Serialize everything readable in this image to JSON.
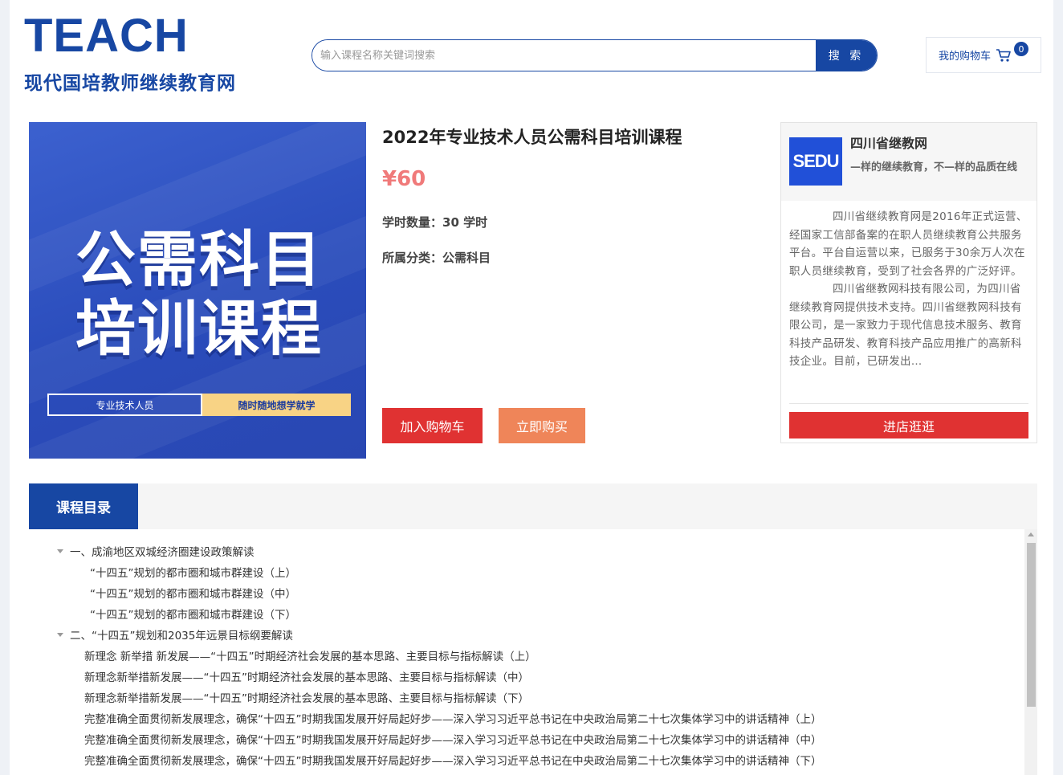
{
  "header": {
    "logo_word": "TEACH",
    "logo_subtitle": "现代国培教师继续教育网",
    "search_placeholder": "输入课程名称关键词搜索",
    "search_button": "搜 索",
    "cart_label": "我的购物车",
    "cart_count": "0"
  },
  "cover": {
    "line1": "公需科目",
    "line2": "培训课程",
    "tag_left": "专业技术人员",
    "tag_right": "随时随地想学就学"
  },
  "product": {
    "title": "2022年专业技术人员公需科目培训课程",
    "price": "¥60",
    "hours_label": "学时数量：",
    "hours_value": "30 学时",
    "category_label": "所属分类：",
    "category_value": "公需科目",
    "add_cart_button": "加入购物车",
    "buy_now_button": "立即购买"
  },
  "store": {
    "logo_text": "SEDU",
    "name": "四川省继教网",
    "slogan": "—样的继续教育，不—样的品质在线",
    "desc_p1": "四川省继续教育网是2016年正式运营、经国家工信部备案的在职人员继续教育公共服务平台。平台自运营以来，已服务于30余万人次在职人员继续教育，受到了社会各界的广泛好评。",
    "desc_p2": "四川省继教网科技有限公司，为四川省继续教育网提供技术支持。四川省继教网科技有限公司，是一家致力于现代信息技术服务、教育科技产品研发、教育科技产品应用推广的高新科技企业。目前，已研发出…",
    "visit_button": "进店逛逛"
  },
  "catalog": {
    "tab_label": "课程目录",
    "items": [
      {
        "text": "一、成渝地区双城经济圈建设政策解读",
        "level": 0
      },
      {
        "text": "“十四五”规划的都市圈和城市群建设（上）",
        "level": 1
      },
      {
        "text": "“十四五”规划的都市圈和城市群建设（中）",
        "level": 1
      },
      {
        "text": "“十四五”规划的都市圈和城市群建设（下）",
        "level": 1
      },
      {
        "text": "二、“十四五”规划和2035年远景目标纲要解读",
        "level": 0
      },
      {
        "text": "新理念 新举措 新发展——“十四五”时期经济社会发展的基本思路、主要目标与指标解读（上）",
        "level": 1
      },
      {
        "text": "新理念新举措新发展——“十四五”时期经济社会发展的基本思路、主要目标与指标解读（中）",
        "level": 1
      },
      {
        "text": "新理念新举措新发展——“十四五”时期经济社会发展的基本思路、主要目标与指标解读（下）",
        "level": 1
      },
      {
        "text": "完整准确全面贯彻新发展理念，确保“十四五”时期我国发展开好局起好步——深入学习习近平总书记在中央政治局第二十七次集体学习中的讲话精神（上）",
        "level": 1
      },
      {
        "text": "完整准确全面贯彻新发展理念，确保“十四五”时期我国发展开好局起好步——深入学习习近平总书记在中央政治局第二十七次集体学习中的讲话精神（中）",
        "level": 1
      },
      {
        "text": "完整准确全面贯彻新发展理念，确保“十四五”时期我国发展开好局起好步——深入学习习近平总书记在中央政治局第二十七次集体学习中的讲话精神（下）",
        "level": 1
      }
    ]
  },
  "colors": {
    "brand_blue": "#1747a3",
    "cart_red": "#e03232",
    "buy_orange": "#ef8559",
    "price_pink": "#f07a7a"
  }
}
